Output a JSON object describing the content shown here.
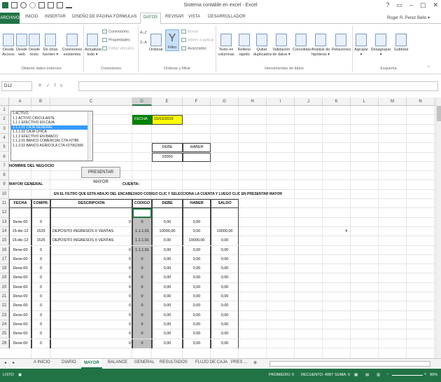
{
  "window": {
    "title": "Sistema contable en excel - Excel",
    "buttons": [
      "?",
      "▭",
      "–",
      "▢",
      "✕"
    ]
  },
  "ribbon_tabs": [
    "ARCHIVO",
    "INICIO",
    "INSERTAR",
    "DISEÑO DE PÁGINA",
    "FÓRMULAS",
    "DATOS",
    "REVISAR",
    "VISTA",
    "DESARROLLADOR"
  ],
  "user": "Roger R. Perez Bello ▾",
  "ribbon": {
    "get_external": [
      "Desde Access",
      "Desde web",
      "Desde texto",
      "De otras fuentes ▾",
      "Conexiones existentes"
    ],
    "refresh": "Actualizar todo ▾",
    "connections_small": [
      "Conexiones",
      "Propiedades",
      "Editar vínculos"
    ],
    "sort_small": "Ordenar",
    "filter": "Filtro",
    "filter_small": [
      "Borrar",
      "Volver a aplicar",
      "Avanzadas"
    ],
    "data_tools": [
      "Texto en columnas",
      "Relleno rápido",
      "Quitar duplicados",
      "Validación de datos ▾",
      "Consolidar",
      "Análisis de hipótesis ▾",
      "Relaciones"
    ],
    "outline": [
      "Agrupar ▾",
      "Desagrupar ▾",
      "Subtotal"
    ],
    "groups": [
      "Obtener datos externos",
      "Conexiones",
      "Ordenar y filtrar",
      "Herramientas de datos",
      "Esquema"
    ]
  },
  "formula_bar": {
    "name_box": "D12",
    "fx": "fx",
    "content": ""
  },
  "columns": [
    "A",
    "B",
    "C",
    "D",
    "E",
    "F",
    "G",
    "H",
    "I",
    "J",
    "K",
    "L",
    "M",
    "N",
    "O"
  ],
  "rows": [
    "1",
    "2",
    "3",
    "4",
    "5",
    "6",
    "7",
    "8",
    "9",
    "10",
    "11",
    "12",
    "13",
    "14",
    "15",
    "16",
    "17",
    "18",
    "19",
    "20",
    "21",
    "22",
    "23",
    "24",
    "25",
    "26"
  ],
  "listbox": {
    "items": [
      "1 ACTIVO",
      "1.1 ACTIVO CIRCULANTE",
      "1.1.1 EFECTIVO EN CAJA",
      "1.1.1.01 CAJA GENERAL",
      "1.1.1.02 CAJA CHICA",
      "1.1.2 EFECTIVO EN BANCO",
      "1.1.2.01 BANCO COMERCIAL CTA #2788",
      "1.1.2.02 BANCO AGRICOLA CTA #27062306"
    ],
    "selected_index": 3
  },
  "sheet": {
    "fecha_label": "FECHA",
    "fecha_value": "15/01/2019",
    "debe_label": "DEBE",
    "haber_label": "HABER",
    "debe_value": "10000",
    "nombre_negocio": "NOMBRE DEL NEGOCIO",
    "presentar_button": "PRESENTAR MAYOR",
    "mayor_general": "MAYOR GENERAL",
    "cuenta": "CUENTA:",
    "instruction": "EN EL FILTRO QUE ESTA ABAJO DEL ENCABEZADO CODIGO CLIC Y SELECCIONA LA CUENTA Y LUEGO CLIC EN PRESENTAR MAYOR",
    "headers": [
      "FECHA",
      "COMPR.",
      "DESCRIPCION",
      "CODIGO",
      "DEBE",
      "HABER",
      "SALDO"
    ],
    "stray_value": "4",
    "rows": [
      {
        "row": 12,
        "fecha": "",
        "compr": "",
        "desc": "",
        "zero": "",
        "codigo": "",
        "debe": "",
        "haber": "",
        "saldo": ""
      },
      {
        "row": 13,
        "fecha": "Dene-00",
        "compr": "0",
        "desc": "",
        "zero": "0",
        "codigo": "0",
        "debe": "0,00",
        "haber": "0,00",
        "saldo": ""
      },
      {
        "row": 14,
        "fecha": "15-dic-12",
        "compr": "1525",
        "desc": "DEPOSITO INGRESOS X VENTAS",
        "zero": "",
        "codigo": "1.1.1.01",
        "debe": "10000,00",
        "haber": "0,00",
        "saldo": "10000,00"
      },
      {
        "row": 15,
        "fecha": "15-dic-12",
        "compr": "1525",
        "desc": "DEPOSITO INGRESOS X VENTAS",
        "zero": "",
        "codigo": "1.1.1.01",
        "debe": "0,00",
        "haber": "10000,00",
        "saldo": "0,00"
      },
      {
        "row": 16,
        "fecha": "Dene-00",
        "compr": "0",
        "desc": "",
        "zero": "0",
        "codigo": "1.1.1.01",
        "debe": "0,00",
        "haber": "0,00",
        "saldo": "0,00"
      },
      {
        "row": 17,
        "fecha": "Dene-00",
        "compr": "0",
        "desc": "",
        "zero": "0",
        "codigo": "0",
        "debe": "0,00",
        "haber": "0,00",
        "saldo": "0,00"
      },
      {
        "row": 18,
        "fecha": "Dene-00",
        "compr": "0",
        "desc": "",
        "zero": "0",
        "codigo": "0",
        "debe": "0,00",
        "haber": "0,00",
        "saldo": "0,00"
      },
      {
        "row": 19,
        "fecha": "Dene-00",
        "compr": "0",
        "desc": "",
        "zero": "0",
        "codigo": "0",
        "debe": "0,00",
        "haber": "0,00",
        "saldo": "0,00"
      },
      {
        "row": 20,
        "fecha": "Dene-00",
        "compr": "0",
        "desc": "",
        "zero": "0",
        "codigo": "0",
        "debe": "0,00",
        "haber": "0,00",
        "saldo": "0,00"
      },
      {
        "row": 21,
        "fecha": "Dene-00",
        "compr": "0",
        "desc": "",
        "zero": "0",
        "codigo": "0",
        "debe": "0,00",
        "haber": "0,00",
        "saldo": "0,00"
      },
      {
        "row": 22,
        "fecha": "Dene-00",
        "compr": "0",
        "desc": "",
        "zero": "0",
        "codigo": "0",
        "debe": "0,00",
        "haber": "0,00",
        "saldo": "0,00"
      },
      {
        "row": 23,
        "fecha": "Dene-00",
        "compr": "0",
        "desc": "",
        "zero": "0",
        "codigo": "0",
        "debe": "0,00",
        "haber": "0,00",
        "saldo": "0,00"
      },
      {
        "row": 24,
        "fecha": "Dene-00",
        "compr": "0",
        "desc": "",
        "zero": "0",
        "codigo": "0",
        "debe": "0,00",
        "haber": "0,00",
        "saldo": "0,00"
      },
      {
        "row": 25,
        "fecha": "Dene-00",
        "compr": "0",
        "desc": "",
        "zero": "0",
        "codigo": "0",
        "debe": "0,00",
        "haber": "0,00",
        "saldo": "0,00"
      },
      {
        "row": 26,
        "fecha": "Dene-00",
        "compr": "0",
        "desc": "",
        "zero": "0",
        "codigo": "0",
        "debe": "0,00",
        "haber": "0,00",
        "saldo": "0,00"
      }
    ]
  },
  "sheet_tabs": [
    "A INICIO",
    "DIARIO",
    "MAYOR",
    "BALANCE",
    "GENERAL",
    "RESULTADOS",
    "FLUJO DE CAJA",
    "PRES ..."
  ],
  "active_sheet": "MAYOR",
  "status": {
    "mode": "LISTO",
    "promedio": "PROMEDIO: 0",
    "recuento": "RECUENTO: 4087",
    "suma": "SUMA: 0",
    "zoom": "90%"
  },
  "colors": {
    "accent": "#217346",
    "fecha_green": "#008000",
    "fecha_yellow": "#ffff00",
    "codigo_gray": "#bfbfbf"
  }
}
